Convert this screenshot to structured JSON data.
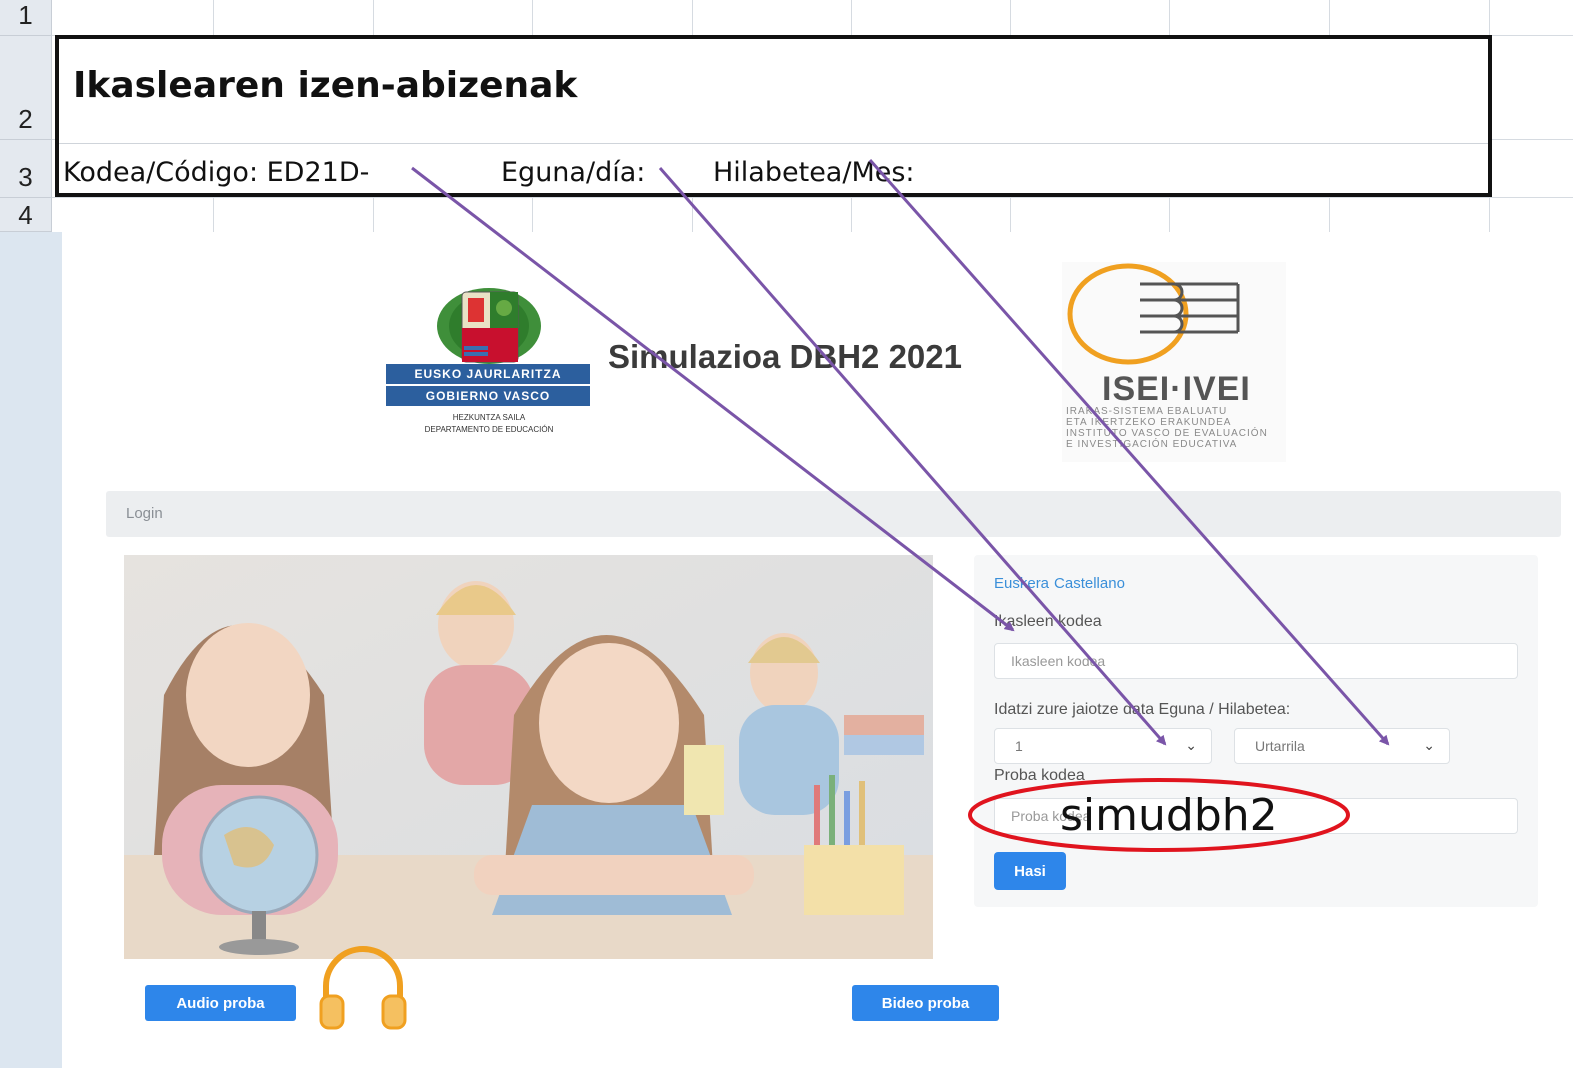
{
  "sheet": {
    "row_numbers": [
      "1",
      "2",
      "3",
      "4"
    ],
    "title": "Ikaslearen izen-abizenak",
    "code_label": "Kodea/Código: ED21D-",
    "day_label": "Eguna/día:",
    "month_label": "Hilabetea/Mes:"
  },
  "header": {
    "gv_line1": "EUSKO JAURLARITZA",
    "gv_line2": "GOBIERNO VASCO",
    "gv_dept1": "HEZKUNTZA SAILA",
    "gv_dept2": "DEPARTAMENTO DE EDUCACIÓN",
    "title": "Simulazioa DBH2 2021",
    "isei_name": "ISEI·IVEI",
    "isei_sub1": "IRAKAS-SISTEMA EBALUATU",
    "isei_sub2": "ETA IKERTZEKO ERAKUNDEA",
    "isei_sub3": "INSTITUTO VASCO DE EVALUACIÓN",
    "isei_sub4": "E INVESTIGACIÓN EDUCATIVA"
  },
  "breadcrumb": "Login",
  "form": {
    "lang_eu": "Euskera",
    "lang_es": "Castellano",
    "student_code_label": "Ikasleen kodea",
    "student_code_placeholder": "Ikasleen kodea",
    "birth_label": "Idatzi zure jaiotze data Eguna / Hilabetea:",
    "day_value": "1",
    "month_value": "Urtarrila",
    "test_code_label": "Proba kodea",
    "test_code_placeholder": "Proba kodea",
    "start_button": "Hasi"
  },
  "buttons": {
    "audio": "Audio proba",
    "video": "Bideo proba"
  },
  "annotation": {
    "handwritten_code": "simudbh2"
  },
  "colors": {
    "primary": "#2e86ea",
    "arrow": "#7a55a8",
    "highlight_ellipse": "#e0141e",
    "headphones": "#f5a623"
  }
}
